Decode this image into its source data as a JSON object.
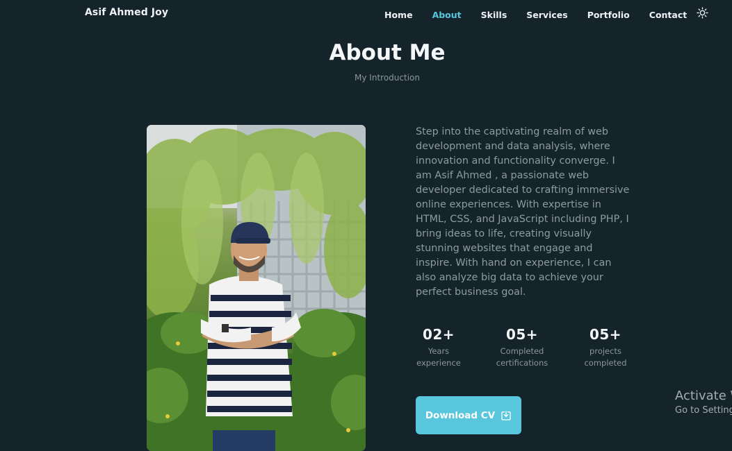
{
  "header": {
    "logo": "Asif Ahmed Joy",
    "nav": [
      {
        "label": "Home",
        "active": false
      },
      {
        "label": "About",
        "active": true
      },
      {
        "label": "Skills",
        "active": false
      },
      {
        "label": "Services",
        "active": false
      },
      {
        "label": "Portfolio",
        "active": false
      },
      {
        "label": "Contact",
        "active": false
      }
    ],
    "theme_toggle_icon": "sun-icon"
  },
  "about": {
    "title": "About Me",
    "subtitle": "My Introduction",
    "photo_icon": "profile-photo",
    "description": "Step into the captivating realm of web development and data analysis, where innovation and functionality converge. I am Asif Ahmed , a passionate web developer dedicated to crafting immersive online experiences. With expertise in HTML, CSS, and JavaScript including PHP, I bring ideas to life, creating visually stunning websites that engage and inspire. With hand on experience, I can also analyze big data to achieve your perfect business goal.",
    "stats": [
      {
        "value": "02+",
        "label_line1": "Years",
        "label_line2": "experience"
      },
      {
        "value": "05+",
        "label_line1": "Completed",
        "label_line2": "certifications"
      },
      {
        "value": "05+",
        "label_line1": "projects",
        "label_line2": "completed"
      }
    ],
    "download_button": "Download CV",
    "download_icon": "download-icon"
  },
  "os_watermark": {
    "title": "Activate W",
    "subtitle": "Go to Setting"
  },
  "colors": {
    "background": "#15232a",
    "accent": "#58c6dd",
    "text": "#eef3f5",
    "muted": "#8d9ca2"
  }
}
